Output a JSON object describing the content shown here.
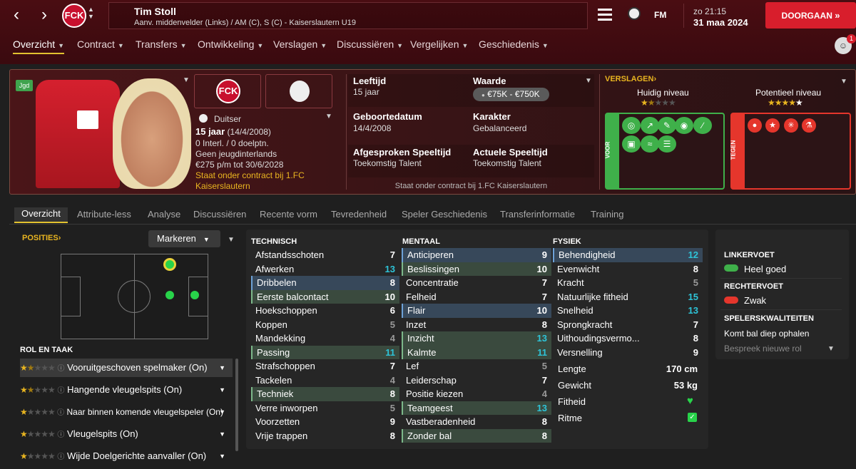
{
  "header": {
    "player_name": "Tim Stoll",
    "player_sub": "Aanv. middenvelder (Links) / AM (C), S (C) - Kaiserslautern U19",
    "club_badge_text": "FCK",
    "time": "zo 21:15",
    "date": "31 maa 2024",
    "continue_label": "DOORGAAN",
    "fm_label": "FM",
    "notif_count": "1"
  },
  "menu": [
    "Overzicht",
    "Contract",
    "Transfers",
    "Ontwikkeling",
    "Verslagen",
    "Discussiëren",
    "Vergelijken",
    "Geschiedenis"
  ],
  "card": {
    "youth_tag": "Jgd",
    "nationality": "Duitser",
    "age_line": "15 jaar",
    "dob_short": "(14/4/2008)",
    "caps": "0 Interl. / 0 doelptn.",
    "youth_caps": "Geen jeugdinterlands",
    "wage": "€275 p/m tot 30/6/2028",
    "contract_note": "Staat onder contract bij 1.FC Kaiserslautern",
    "age_label": "Leeftijd",
    "age_value": "15 jaar",
    "value_label": "Waarde",
    "value_value": "€75K - €750K",
    "dob_label": "Geboortedatum",
    "dob_value": "14/4/2008",
    "char_label": "Karakter",
    "char_value": "Gebalanceerd",
    "agreed_label": "Afgesproken Speeltijd",
    "agreed_value": "Toekomstig Talent",
    "actual_label": "Actuele Speeltijd",
    "actual_value": "Toekomstig Talent",
    "footer": "Staat onder contract bij 1.FC Kaiserslautern",
    "reports_label": "VERSLAGEN",
    "current_label": "Huidig niveau",
    "potential_label": "Potentieel niveau",
    "current_stars": 1.5,
    "potential_stars": 4,
    "pros_label": "VOOR",
    "cons_label": "TEGEN"
  },
  "tabs": [
    "Overzicht",
    "Attribute-less",
    "Analyse",
    "Discussiëren",
    "Recente vorm",
    "Tevredenheid",
    "Speler Geschiedenis",
    "Transferinformatie",
    "Training"
  ],
  "positions": {
    "label": "POSITIES",
    "mark_label": "Markeren"
  },
  "roles": {
    "label": "ROL EN TAAK",
    "items": [
      {
        "name": "Vooruitgeschoven spelmaker (On)",
        "stars": "★★☆☆☆",
        "half": true
      },
      {
        "name": "Hangende vleugelspits (On)",
        "stars": "★★☆☆☆",
        "half": true
      },
      {
        "name": "Naar binnen komende vleugelspeler (On)",
        "stars": "★☆☆☆☆",
        "half": false
      },
      {
        "name": "Vleugelspits (On)",
        "stars": "★☆☆☆☆",
        "half": false
      },
      {
        "name": "Wijde Doelgerichte aanvaller (On)",
        "stars": "★☆☆☆☆",
        "half": false
      }
    ]
  },
  "attributes": {
    "technical_label": "TECHNISCH",
    "mental_label": "MENTAAL",
    "physical_label": "FYSIEK",
    "technical": [
      [
        "Afstandsschoten",
        "7"
      ],
      [
        "Afwerken",
        "13"
      ],
      [
        "Dribbelen",
        "8"
      ],
      [
        "Eerste balcontact",
        "10"
      ],
      [
        "Hoekschoppen",
        "6"
      ],
      [
        "Koppen",
        "5"
      ],
      [
        "Mandekking",
        "4"
      ],
      [
        "Passing",
        "11"
      ],
      [
        "Strafschoppen",
        "7"
      ],
      [
        "Tackelen",
        "4"
      ],
      [
        "Techniek",
        "8"
      ],
      [
        "Verre inworpen",
        "5"
      ],
      [
        "Voorzetten",
        "9"
      ],
      [
        "Vrije trappen",
        "8"
      ]
    ],
    "mental": [
      [
        "Anticiperen",
        "9"
      ],
      [
        "Beslissingen",
        "10"
      ],
      [
        "Concentratie",
        "7"
      ],
      [
        "Felheid",
        "7"
      ],
      [
        "Flair",
        "10"
      ],
      [
        "Inzet",
        "8"
      ],
      [
        "Inzicht",
        "13"
      ],
      [
        "Kalmte",
        "11"
      ],
      [
        "Lef",
        "5"
      ],
      [
        "Leiderschap",
        "7"
      ],
      [
        "Positie kiezen",
        "4"
      ],
      [
        "Teamgeest",
        "13"
      ],
      [
        "Vastberadenheid",
        "8"
      ],
      [
        "Zonder bal",
        "8"
      ]
    ],
    "physical": [
      [
        "Behendigheid",
        "12"
      ],
      [
        "Evenwicht",
        "8"
      ],
      [
        "Kracht",
        "5"
      ],
      [
        "Natuurlijke fitheid",
        "15"
      ],
      [
        "Snelheid",
        "13"
      ],
      [
        "Sprongkracht",
        "7"
      ],
      [
        "Uithoudingsvermo...",
        "8"
      ],
      [
        "Versnelling",
        "9"
      ]
    ],
    "height_label": "Lengte",
    "height_value": "170 cm",
    "weight_label": "Gewicht",
    "weight_value": "53 kg",
    "fitness_label": "Fitheid",
    "rhythm_label": "Ritme"
  },
  "side": {
    "left_foot_label": "LINKERVOET",
    "left_foot_value": "Heel goed",
    "right_foot_label": "RECHTERVOET",
    "right_foot_value": "Zwak",
    "qualities_label": "SPELERSKWALITEITEN",
    "quality_1": "Komt bal diep ophalen",
    "discuss_role": "Bespreek nieuwe rol"
  },
  "colors": {
    "accent_red": "#d81e2c",
    "highlight_cyan": "#2ec4d8",
    "pro_green": "#3fb04a",
    "con_red": "#e5362c"
  }
}
